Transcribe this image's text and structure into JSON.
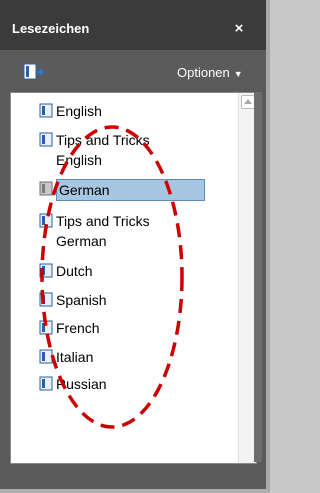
{
  "panel": {
    "title": "Lesezeichen",
    "close_label": "×",
    "options_label": "Optionen",
    "options_arrow": "▼"
  },
  "bookmarks": [
    {
      "label": "English",
      "selected": false
    },
    {
      "label": "Tips and Tricks English",
      "selected": false
    },
    {
      "label": "German",
      "selected": true
    },
    {
      "label": "Tips and Tricks German",
      "selected": false
    },
    {
      "label": "Dutch",
      "selected": false
    },
    {
      "label": "Spanish",
      "selected": false
    },
    {
      "label": "French",
      "selected": false
    },
    {
      "label": "Italian",
      "selected": false
    },
    {
      "label": "Russian",
      "selected": false
    }
  ],
  "colors": {
    "panel_bg": "#5a5a5a",
    "titlebar_bg": "#3b3b3b",
    "selection": "#a7c6e2",
    "selection_border": "#5f89b9",
    "annotation": "#cc0000"
  },
  "icons": {
    "close": "close-icon",
    "bookmark_tool": "bookmark-tool-icon",
    "item": "bookmark-icon"
  }
}
